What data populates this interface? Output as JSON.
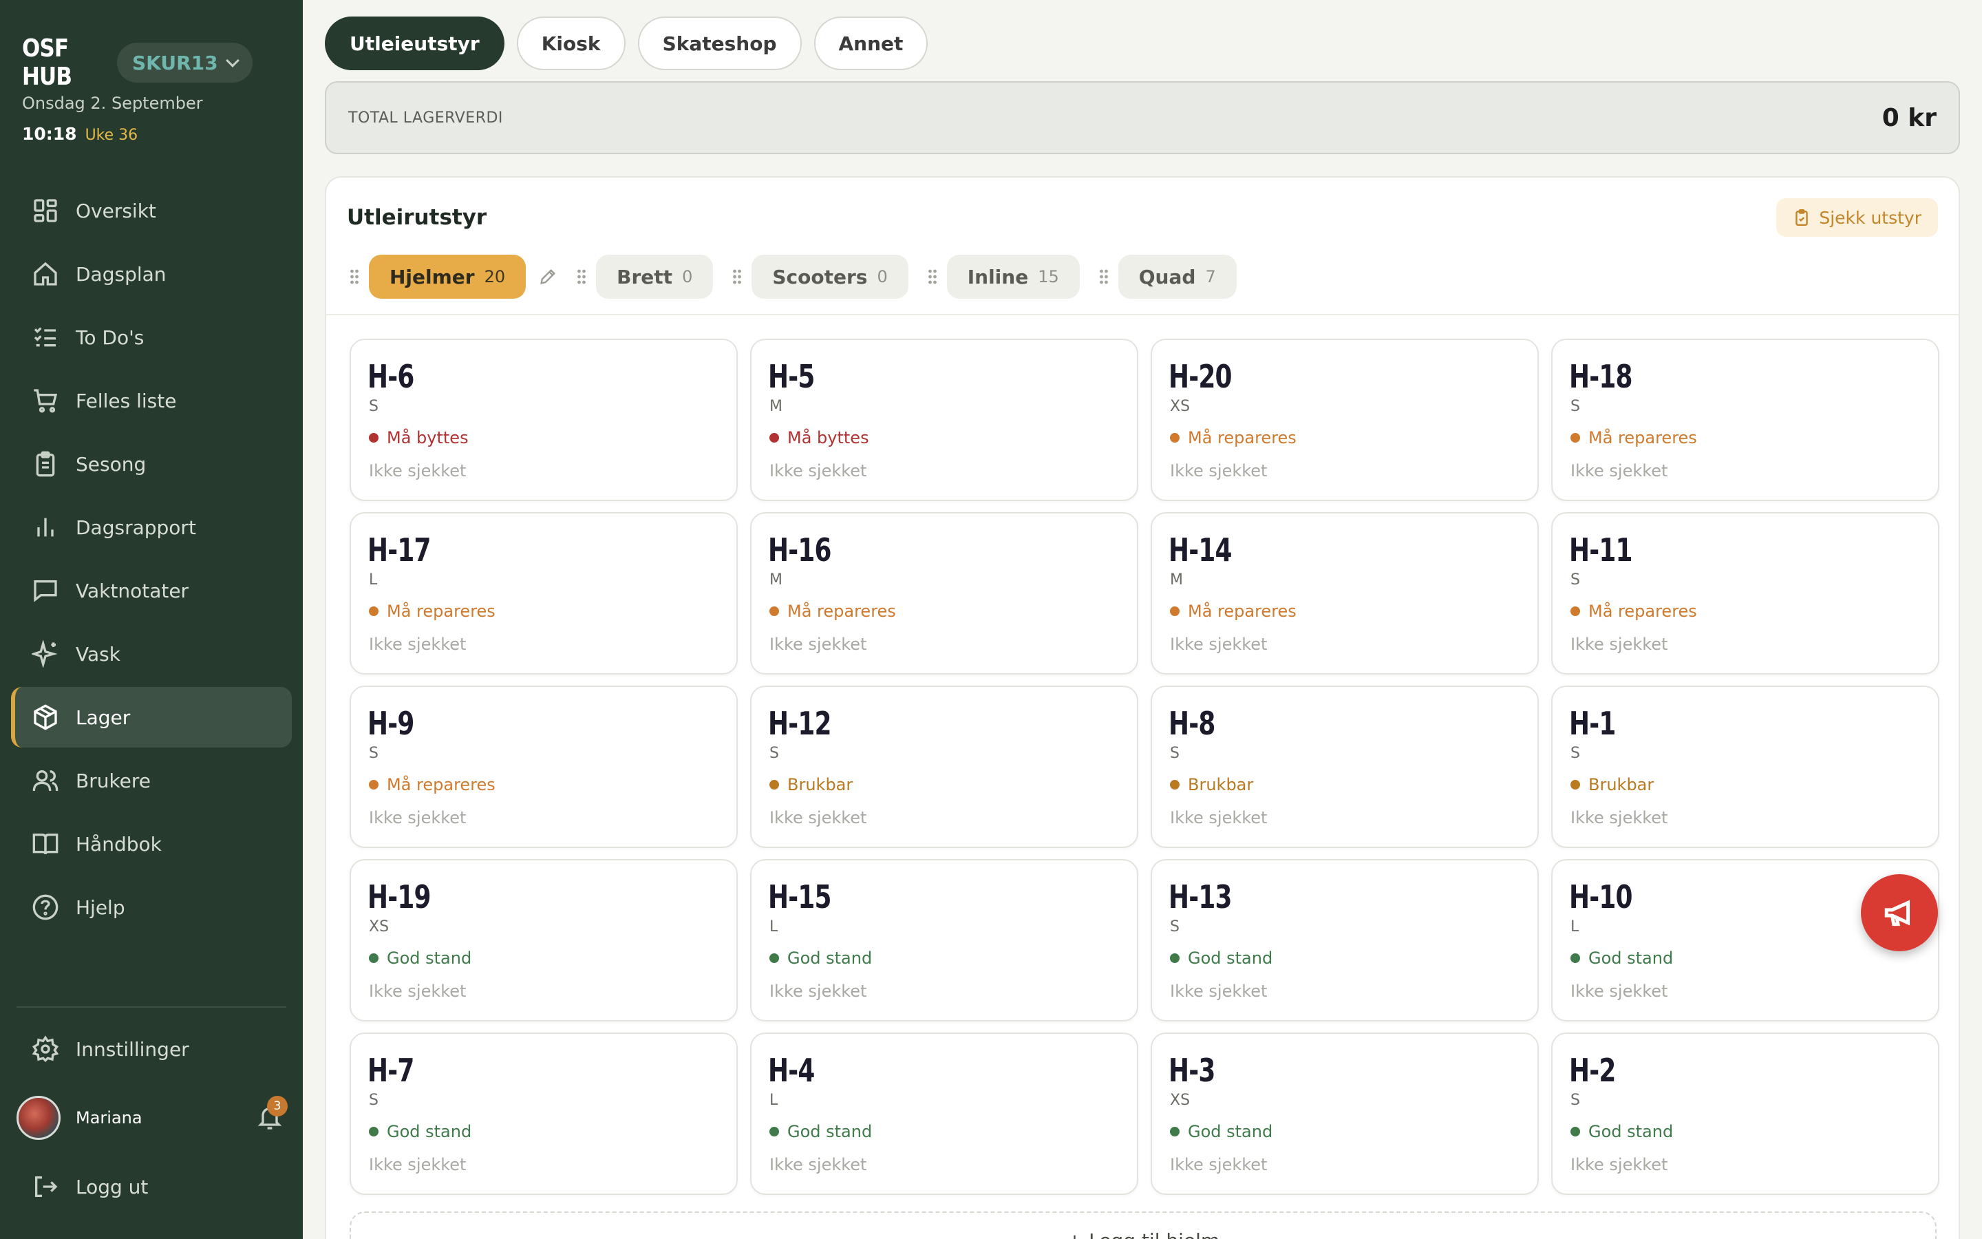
{
  "brand": {
    "name": "OSF HUB",
    "site_code": "SKUR13"
  },
  "datetime": {
    "date": "Onsdag 2. September",
    "time": "10:18",
    "week": "Uke 36"
  },
  "nav": [
    {
      "label": "Oversikt",
      "icon": "grid-icon"
    },
    {
      "label": "Dagsplan",
      "icon": "home-icon"
    },
    {
      "label": "To Do's",
      "icon": "checklist-icon"
    },
    {
      "label": "Felles liste",
      "icon": "cart-icon"
    },
    {
      "label": "Sesong",
      "icon": "clipboard-icon"
    },
    {
      "label": "Dagsrapport",
      "icon": "bar-chart-icon"
    },
    {
      "label": "Vaktnotater",
      "icon": "message-icon"
    },
    {
      "label": "Vask",
      "icon": "sparkles-icon"
    },
    {
      "label": "Lager",
      "icon": "package-icon",
      "active": true
    },
    {
      "label": "Brukere",
      "icon": "users-icon"
    },
    {
      "label": "Håndbok",
      "icon": "book-icon"
    },
    {
      "label": "Hjelp",
      "icon": "help-circle-icon"
    }
  ],
  "settings": {
    "label": "Innstillinger",
    "icon": "gear-icon"
  },
  "user": {
    "name": "Mariana",
    "notifications": "3"
  },
  "logout": {
    "label": "Logg ut",
    "icon": "logout-icon"
  },
  "tabs": [
    {
      "label": "Utleieutstyr",
      "active": true
    },
    {
      "label": "Kiosk"
    },
    {
      "label": "Skateshop"
    },
    {
      "label": "Annet"
    }
  ],
  "total": {
    "label": "TOTAL LAGERVERDI",
    "value": "0 kr"
  },
  "panel": {
    "title": "Utleirutstyr",
    "check_button": "Sjekk utstyr"
  },
  "categories": [
    {
      "name": "Hjelmer",
      "count": "20",
      "active": true
    },
    {
      "name": "Brett",
      "count": "0"
    },
    {
      "name": "Scooters",
      "count": "0"
    },
    {
      "name": "Inline",
      "count": "15"
    },
    {
      "name": "Quad",
      "count": "7"
    }
  ],
  "status_colors": {
    "red": "#b23232",
    "orange": "#d07a2e",
    "amber": "#b97a22",
    "green": "#3f7a4a"
  },
  "items": [
    {
      "id": "H-6",
      "size": "S",
      "status": "Må byttes",
      "tone": "red",
      "checked": "Ikke sjekket"
    },
    {
      "id": "H-5",
      "size": "M",
      "status": "Må byttes",
      "tone": "red",
      "checked": "Ikke sjekket"
    },
    {
      "id": "H-20",
      "size": "XS",
      "status": "Må repareres",
      "tone": "orange",
      "checked": "Ikke sjekket"
    },
    {
      "id": "H-18",
      "size": "S",
      "status": "Må repareres",
      "tone": "orange",
      "checked": "Ikke sjekket"
    },
    {
      "id": "H-17",
      "size": "L",
      "status": "Må repareres",
      "tone": "orange",
      "checked": "Ikke sjekket"
    },
    {
      "id": "H-16",
      "size": "M",
      "status": "Må repareres",
      "tone": "orange",
      "checked": "Ikke sjekket"
    },
    {
      "id": "H-14",
      "size": "M",
      "status": "Må repareres",
      "tone": "orange",
      "checked": "Ikke sjekket"
    },
    {
      "id": "H-11",
      "size": "S",
      "status": "Må repareres",
      "tone": "orange",
      "checked": "Ikke sjekket"
    },
    {
      "id": "H-9",
      "size": "S",
      "status": "Må repareres",
      "tone": "orange",
      "checked": "Ikke sjekket"
    },
    {
      "id": "H-12",
      "size": "S",
      "status": "Brukbar",
      "tone": "amber",
      "checked": "Ikke sjekket"
    },
    {
      "id": "H-8",
      "size": "S",
      "status": "Brukbar",
      "tone": "amber",
      "checked": "Ikke sjekket"
    },
    {
      "id": "H-1",
      "size": "S",
      "status": "Brukbar",
      "tone": "amber",
      "checked": "Ikke sjekket"
    },
    {
      "id": "H-19",
      "size": "XS",
      "status": "God stand",
      "tone": "green",
      "checked": "Ikke sjekket"
    },
    {
      "id": "H-15",
      "size": "L",
      "status": "God stand",
      "tone": "green",
      "checked": "Ikke sjekket"
    },
    {
      "id": "H-13",
      "size": "S",
      "status": "God stand",
      "tone": "green",
      "checked": "Ikke sjekket"
    },
    {
      "id": "H-10",
      "size": "L",
      "status": "God stand",
      "tone": "green",
      "checked": "Ikke sjekket"
    },
    {
      "id": "H-7",
      "size": "S",
      "status": "God stand",
      "tone": "green",
      "checked": "Ikke sjekket"
    },
    {
      "id": "H-4",
      "size": "L",
      "status": "God stand",
      "tone": "green",
      "checked": "Ikke sjekket"
    },
    {
      "id": "H-3",
      "size": "XS",
      "status": "God stand",
      "tone": "green",
      "checked": "Ikke sjekket"
    },
    {
      "id": "H-2",
      "size": "S",
      "status": "God stand",
      "tone": "green",
      "checked": "Ikke sjekket"
    }
  ],
  "add_button": "+ Legg til hjelm",
  "fab": {
    "icon": "megaphone-icon"
  }
}
